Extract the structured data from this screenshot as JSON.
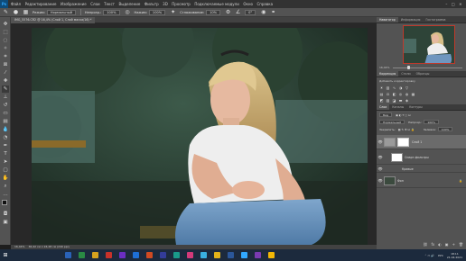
{
  "menubar": {
    "logo": "Ps",
    "items": [
      "Файл",
      "Редактирование",
      "Изображение",
      "Слои",
      "Текст",
      "Выделение",
      "Фильтр",
      "3D",
      "Просмотр",
      "Подключаемые модули",
      "Окно",
      "Справка"
    ],
    "window_controls": [
      "–",
      "□",
      "✕"
    ]
  },
  "options": {
    "mode_label": "Режим:",
    "mode_value": "Нормальный",
    "opacity_label": "Непрозр.:",
    "opacity_value": "100%",
    "flow_label": "Нажим:",
    "flow_value": "100%",
    "smooth_label": "Сглаживание:",
    "smooth_value": "10%",
    "angle_value": "0°"
  },
  "document": {
    "tab_title": "IMG_5576.CR2 @ 16,4% (Слой 1, Слой маска/16) *"
  },
  "statusbar": {
    "zoom": "16,44%",
    "doc_info": "36,42 см x 24,28 см (240 ppi)"
  },
  "panels": {
    "navigator_tabs": [
      "Навигатор",
      "Информация",
      "Гистограмма"
    ],
    "zoom_value": "16,44%",
    "adjustments_tabs": [
      "Коррекция",
      "Стили",
      "Образцы"
    ],
    "adjustments_hint": "Добавить корректировку",
    "layers_tabs": [
      "Слои",
      "Каналы",
      "Контуры"
    ],
    "blend_mode": "Нормальный",
    "opacity_label": "Непрозр.:",
    "opacity_value": "100%",
    "lock_label": "Закрепить:",
    "fill_label": "Заливка:",
    "fill_value": "100%",
    "kind_label": "Вид",
    "layers": [
      {
        "name": "Слой 1",
        "thumb": "#9a9a9a",
        "has_mask": true
      },
      {
        "name": "Смарт-фильтры",
        "thumb": "#ffffff",
        "has_mask": false
      },
      {
        "name": "Фон",
        "thumb": "#3b4a3e",
        "has_mask": false
      }
    ],
    "layer_sub_item": "Кривые",
    "bottom_icons": [
      "fx",
      "◐",
      "▣",
      "+",
      "🗑"
    ]
  },
  "taskbar": {
    "time": "18:11",
    "date": "21.04.2021",
    "lang": "РУС",
    "apps_colors": [
      "#2a62b8",
      "#2a8a44",
      "#d6a21e",
      "#c8322a",
      "#6a2ec4",
      "#1e6fd6",
      "#d04a22",
      "#333c9a",
      "#1a9a8a",
      "#d33a7a",
      "#3ab0e0",
      "#e2b31a",
      "#2b579a",
      "#31a8ff",
      "#7a3ab0",
      "#f2b705"
    ]
  },
  "colors": {
    "accent": "#31a8ff",
    "navigator_frame": "#c0392b"
  }
}
